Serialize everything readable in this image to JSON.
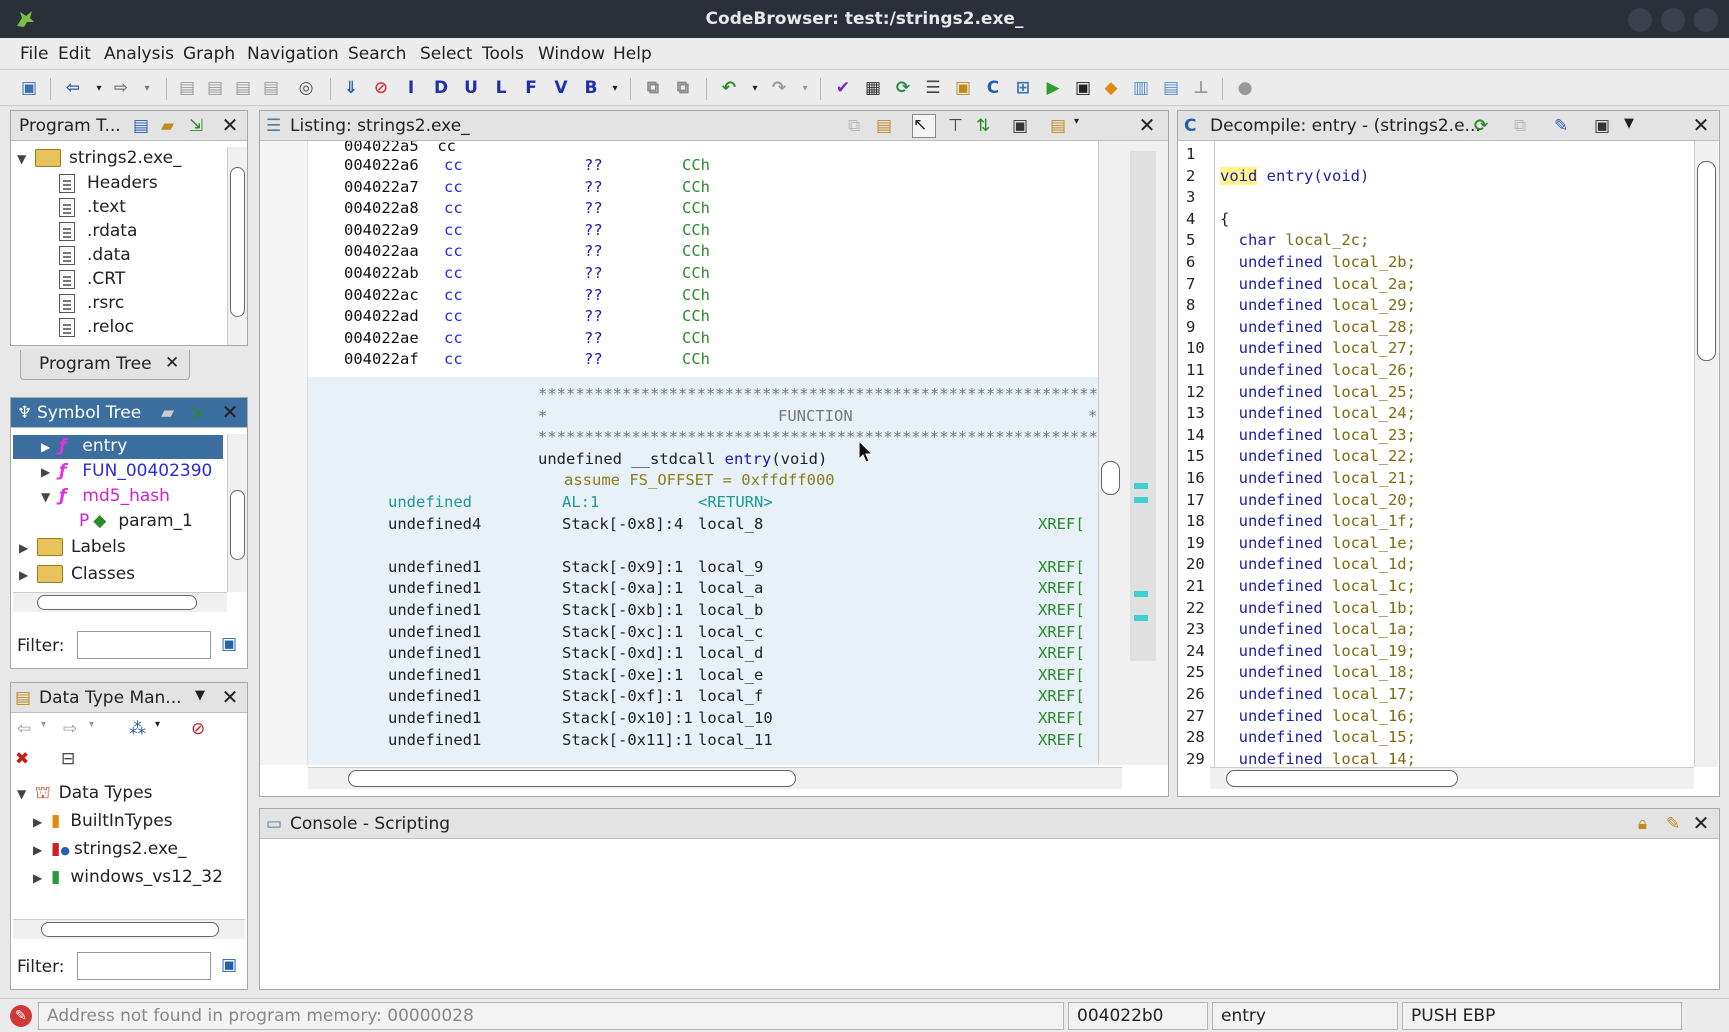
{
  "window": {
    "title": "CodeBrowser: test:/strings2.exe_"
  },
  "menu": [
    "File",
    "Edit",
    "Analysis",
    "Graph",
    "Navigation",
    "Search",
    "Select",
    "Tools",
    "Window",
    "Help"
  ],
  "program_tree": {
    "title": "Program T...",
    "root": "strings2.exe_",
    "items": [
      "Headers",
      ".text",
      ".rdata",
      ".data",
      ".CRT",
      ".rsrc",
      ".reloc"
    ],
    "tab_label": "Program Tree"
  },
  "symbol_tree": {
    "title": "Symbol Tree",
    "items": [
      "entry",
      "FUN_00402390",
      "md5_hash",
      "param_1",
      "Labels",
      "Classes"
    ],
    "filter_label": "Filter:"
  },
  "data_type_manager": {
    "title": "Data Type Man...",
    "root": "Data Types",
    "items": [
      "BuiltInTypes",
      "strings2.exe_",
      "windows_vs12_32"
    ],
    "filter_label": "Filter:"
  },
  "listing": {
    "title": "Listing:  strings2.exe_",
    "top_partial": "004022a5  cc",
    "bytes": [
      {
        "addr": "004022a6",
        "b": "cc",
        "op": "??",
        "v": "CCh"
      },
      {
        "addr": "004022a7",
        "b": "cc",
        "op": "??",
        "v": "CCh"
      },
      {
        "addr": "004022a8",
        "b": "cc",
        "op": "??",
        "v": "CCh"
      },
      {
        "addr": "004022a9",
        "b": "cc",
        "op": "??",
        "v": "CCh"
      },
      {
        "addr": "004022aa",
        "b": "cc",
        "op": "??",
        "v": "CCh"
      },
      {
        "addr": "004022ab",
        "b": "cc",
        "op": "??",
        "v": "CCh"
      },
      {
        "addr": "004022ac",
        "b": "cc",
        "op": "??",
        "v": "CCh"
      },
      {
        "addr": "004022ad",
        "b": "cc",
        "op": "??",
        "v": "CCh"
      },
      {
        "addr": "004022ae",
        "b": "cc",
        "op": "??",
        "v": "CCh"
      },
      {
        "addr": "004022af",
        "b": "cc",
        "op": "??",
        "v": "CCh"
      }
    ],
    "stars": "***************************************************************",
    "function_banner": "FUNCTION",
    "signature_prefix": "undefined __stdcall ",
    "signature_name": "entry",
    "signature_suffix": "(void)",
    "assume": "assume FS_OFFSET = 0xffdff000",
    "ret_type": "undefined",
    "ret_loc": "AL:1",
    "ret_name": "<RETURN>",
    "locals": [
      {
        "type": "undefined4",
        "loc": "Stack[-0x8]:4",
        "name": "local_8",
        "xref": "XREF["
      },
      {
        "type": "undefined1",
        "loc": "Stack[-0x9]:1",
        "name": "local_9",
        "xref": "XREF["
      },
      {
        "type": "undefined1",
        "loc": "Stack[-0xa]:1",
        "name": "local_a",
        "xref": "XREF["
      },
      {
        "type": "undefined1",
        "loc": "Stack[-0xb]:1",
        "name": "local_b",
        "xref": "XREF["
      },
      {
        "type": "undefined1",
        "loc": "Stack[-0xc]:1",
        "name": "local_c",
        "xref": "XREF["
      },
      {
        "type": "undefined1",
        "loc": "Stack[-0xd]:1",
        "name": "local_d",
        "xref": "XREF["
      },
      {
        "type": "undefined1",
        "loc": "Stack[-0xe]:1",
        "name": "local_e",
        "xref": "XREF["
      },
      {
        "type": "undefined1",
        "loc": "Stack[-0xf]:1",
        "name": "local_f",
        "xref": "XREF["
      },
      {
        "type": "undefined1",
        "loc": "Stack[-0x10]:1",
        "name": "local_10",
        "xref": "XREF["
      },
      {
        "type": "undefined1",
        "loc": "Stack[-0x11]:1",
        "name": "local_11",
        "xref": "XREF["
      }
    ]
  },
  "decompile": {
    "title": "Decompile: entry - (strings2.e...",
    "lines": [
      {
        "n": "1",
        "kw": "",
        "rest": ""
      },
      {
        "n": "2",
        "kw": "void",
        "rest": " entry(void)"
      },
      {
        "n": "3",
        "kw": "",
        "rest": ""
      },
      {
        "n": "4",
        "kw": "",
        "rest": "{"
      },
      {
        "n": "5",
        "kw": "  char",
        "rest": " local_2c;"
      },
      {
        "n": "6",
        "kw": "  undefined",
        "rest": " local_2b;"
      },
      {
        "n": "7",
        "kw": "  undefined",
        "rest": " local_2a;"
      },
      {
        "n": "8",
        "kw": "  undefined",
        "rest": " local_29;"
      },
      {
        "n": "9",
        "kw": "  undefined",
        "rest": " local_28;"
      },
      {
        "n": "10",
        "kw": "  undefined",
        "rest": " local_27;"
      },
      {
        "n": "11",
        "kw": "  undefined",
        "rest": " local_26;"
      },
      {
        "n": "12",
        "kw": "  undefined",
        "rest": " local_25;"
      },
      {
        "n": "13",
        "kw": "  undefined",
        "rest": " local_24;"
      },
      {
        "n": "14",
        "kw": "  undefined",
        "rest": " local_23;"
      },
      {
        "n": "15",
        "kw": "  undefined",
        "rest": " local_22;"
      },
      {
        "n": "16",
        "kw": "  undefined",
        "rest": " local_21;"
      },
      {
        "n": "17",
        "kw": "  undefined",
        "rest": " local_20;"
      },
      {
        "n": "18",
        "kw": "  undefined",
        "rest": " local_1f;"
      },
      {
        "n": "19",
        "kw": "  undefined",
        "rest": " local_1e;"
      },
      {
        "n": "20",
        "kw": "  undefined",
        "rest": " local_1d;"
      },
      {
        "n": "21",
        "kw": "  undefined",
        "rest": " local_1c;"
      },
      {
        "n": "22",
        "kw": "  undefined",
        "rest": " local_1b;"
      },
      {
        "n": "23",
        "kw": "  undefined",
        "rest": " local_1a;"
      },
      {
        "n": "24",
        "kw": "  undefined",
        "rest": " local_19;"
      },
      {
        "n": "25",
        "kw": "  undefined",
        "rest": " local_18;"
      },
      {
        "n": "26",
        "kw": "  undefined",
        "rest": " local_17;"
      },
      {
        "n": "27",
        "kw": "  undefined",
        "rest": " local_16;"
      },
      {
        "n": "28",
        "kw": "  undefined",
        "rest": " local_15;"
      },
      {
        "n": "29",
        "kw": "  undefined",
        "rest": " local_14;"
      }
    ]
  },
  "console": {
    "title": "Console - Scripting"
  },
  "status": {
    "message": "Address not found in program memory: 00000028",
    "address": "004022b0",
    "function": "entry",
    "instruction": "PUSH EBP"
  },
  "colors": {
    "titlebar": "#2a2f3a",
    "selection": "#3c6e9f",
    "function_bg": "#e8f0f8"
  }
}
